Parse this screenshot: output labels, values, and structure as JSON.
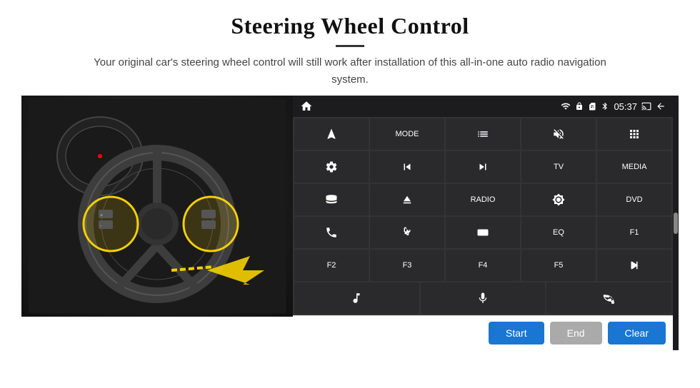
{
  "header": {
    "title": "Steering Wheel Control",
    "divider": true,
    "subtitle": "Your original car's steering wheel control will still work after installation of this all-in-one auto radio navigation system."
  },
  "status_bar": {
    "time": "05:37",
    "icons": [
      "wifi",
      "lock",
      "sim",
      "bluetooth",
      "cast",
      "back"
    ]
  },
  "grid": {
    "rows": [
      [
        {
          "type": "icon",
          "icon": "navigate",
          "label": ""
        },
        {
          "type": "text",
          "label": "MODE"
        },
        {
          "type": "icon",
          "icon": "list",
          "label": ""
        },
        {
          "type": "icon",
          "icon": "mute",
          "label": ""
        },
        {
          "type": "icon",
          "icon": "grid",
          "label": ""
        }
      ],
      [
        {
          "type": "icon",
          "icon": "settings-circle",
          "label": ""
        },
        {
          "type": "icon",
          "icon": "prev",
          "label": ""
        },
        {
          "type": "icon",
          "icon": "next",
          "label": ""
        },
        {
          "type": "text",
          "label": "TV"
        },
        {
          "type": "text",
          "label": "MEDIA"
        }
      ],
      [
        {
          "type": "icon",
          "icon": "360-car",
          "label": ""
        },
        {
          "type": "icon",
          "icon": "eject",
          "label": ""
        },
        {
          "type": "text",
          "label": "RADIO"
        },
        {
          "type": "icon",
          "icon": "brightness",
          "label": ""
        },
        {
          "type": "text",
          "label": "DVD"
        }
      ],
      [
        {
          "type": "icon",
          "icon": "phone",
          "label": ""
        },
        {
          "type": "icon",
          "icon": "swipe",
          "label": ""
        },
        {
          "type": "icon",
          "icon": "rectangle",
          "label": ""
        },
        {
          "type": "text",
          "label": "EQ"
        },
        {
          "type": "text",
          "label": "F1"
        }
      ],
      [
        {
          "type": "text",
          "label": "F2"
        },
        {
          "type": "text",
          "label": "F3"
        },
        {
          "type": "text",
          "label": "F4"
        },
        {
          "type": "text",
          "label": "F5"
        },
        {
          "type": "icon",
          "icon": "play-pause",
          "label": ""
        }
      ]
    ],
    "bottom_row": [
      {
        "type": "icon",
        "icon": "music-note",
        "label": ""
      },
      {
        "type": "icon",
        "icon": "mic",
        "label": ""
      },
      {
        "type": "icon",
        "icon": "phone-call",
        "label": ""
      }
    ]
  },
  "action_buttons": {
    "start": "Start",
    "end": "End",
    "clear": "Clear"
  },
  "colors": {
    "primary_blue": "#1976d2",
    "panel_bg": "#1c1c1e",
    "cell_bg": "#2a2a2c",
    "grid_gap": "#333",
    "button_disabled": "#999"
  }
}
